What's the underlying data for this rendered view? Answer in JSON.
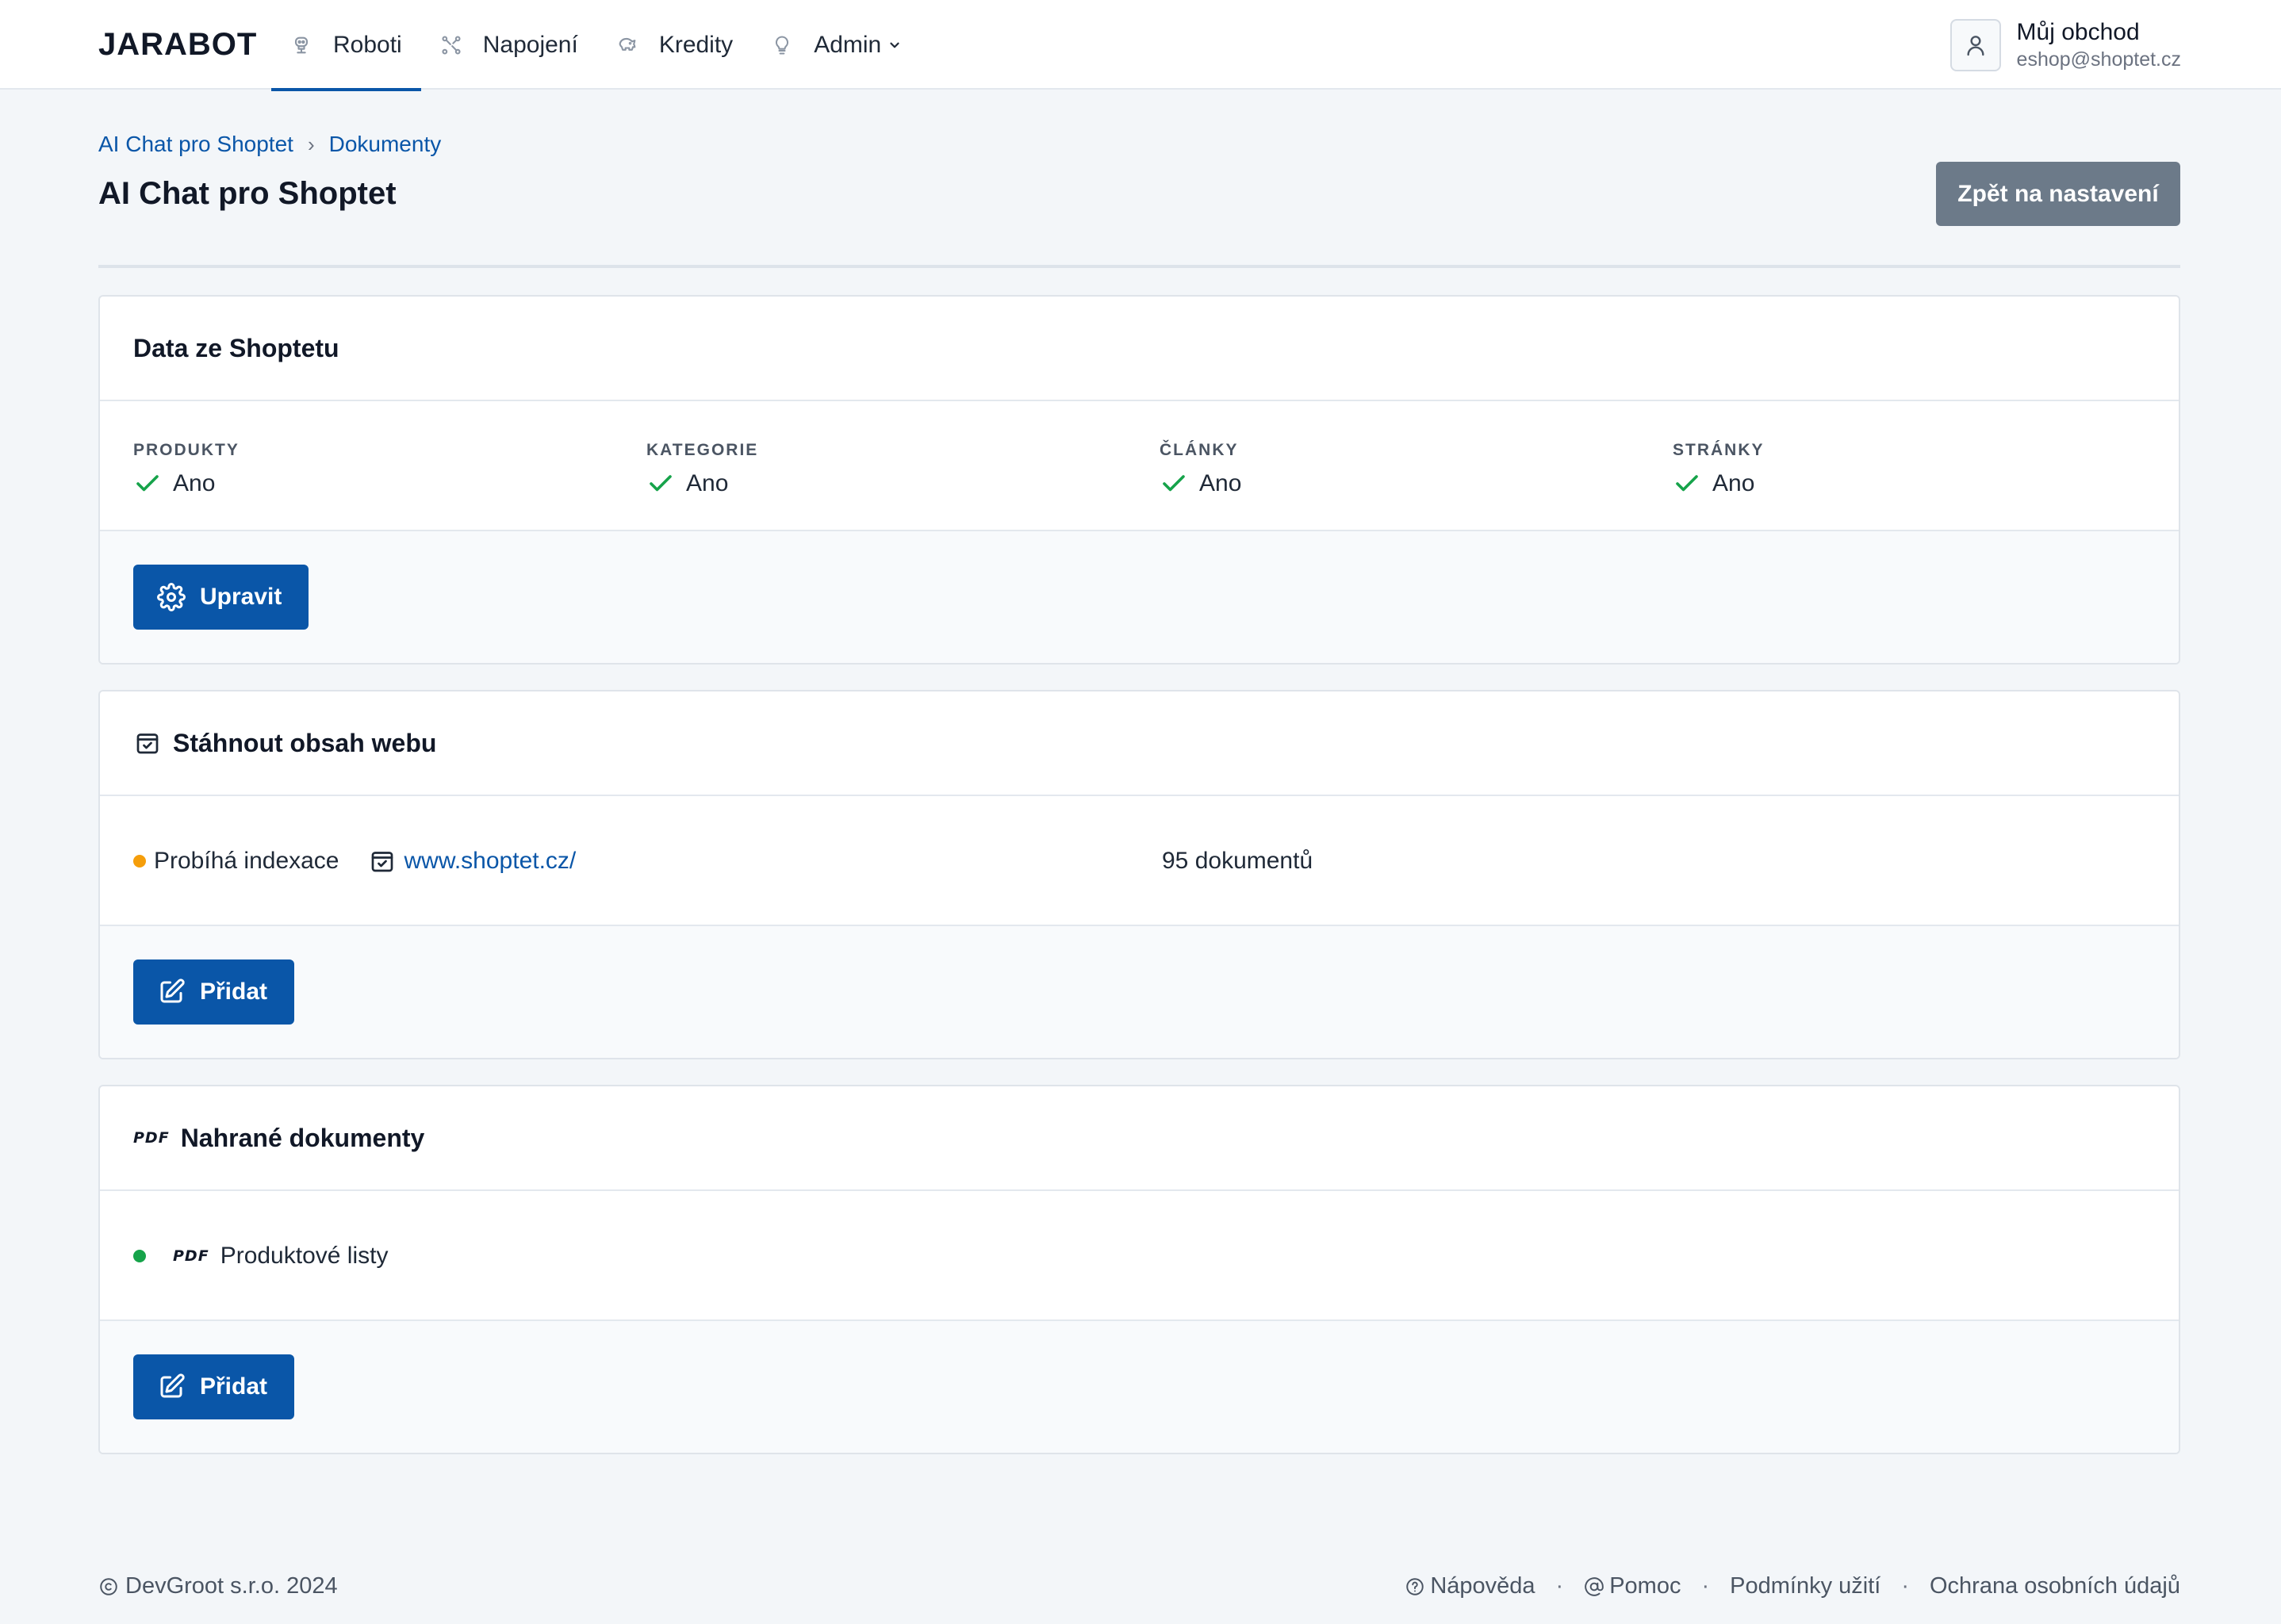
{
  "app": {
    "logo": "JARABOT"
  },
  "nav": {
    "items": [
      {
        "label": "Roboti",
        "icon": "robot-icon",
        "active": true
      },
      {
        "label": "Napojení",
        "icon": "connection-icon",
        "active": false
      },
      {
        "label": "Kredity",
        "icon": "piggy-bank-icon",
        "active": false
      },
      {
        "label": "Admin",
        "icon": "lightbulb-icon",
        "active": false,
        "has_dropdown": true
      }
    ]
  },
  "user": {
    "name": "Můj obchod",
    "email": "eshop@shoptet.cz",
    "icon": "user-icon"
  },
  "breadcrumb": {
    "items": [
      "AI Chat pro Shoptet",
      "Dokumenty"
    ],
    "separator": "›"
  },
  "page": {
    "title": "AI Chat pro Shoptet",
    "back_button": "Zpět na nastavení"
  },
  "shoptet_data": {
    "title": "Data ze Shoptetu",
    "columns": [
      {
        "label": "PRODUKTY",
        "value": "Ano"
      },
      {
        "label": "KATEGORIE",
        "value": "Ano"
      },
      {
        "label": "ČLÁNKY",
        "value": "Ano"
      },
      {
        "label": "STRÁNKY",
        "value": "Ano"
      }
    ],
    "button": "Upravit"
  },
  "web_content": {
    "title": "Stáhnout obsah webu",
    "row": {
      "status": "Probíhá indexace",
      "status_color": "#f59e0b",
      "url": "www.shoptet.cz/",
      "count": "95 dokumentů"
    },
    "button": "Přidat"
  },
  "uploaded_docs": {
    "title": "Nahrané dokumenty",
    "icon_label": "PDF",
    "row": {
      "status_color": "#16a34a",
      "file_badge": "PDF",
      "name": "Produktové listy"
    },
    "button": "Přidat"
  },
  "footer": {
    "copyright": "DevGroot s.r.o. 2024",
    "links": [
      {
        "label": "Nápověda",
        "icon": "question-circle-icon"
      },
      {
        "label": "Pomoc",
        "icon": "at-sign-icon"
      },
      {
        "label": "Podmínky užití",
        "icon": ""
      },
      {
        "label": "Ochrana osobních údajů",
        "icon": ""
      }
    ],
    "separator": "·"
  },
  "colors": {
    "primary": "#0a56a8",
    "secondary_button": "#6c7a89",
    "success": "#16a34a",
    "warning": "#f59e0b",
    "background": "#f3f6f9"
  }
}
